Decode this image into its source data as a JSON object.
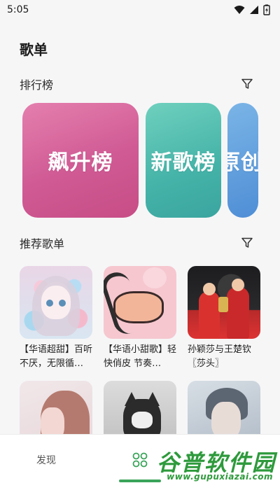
{
  "status": {
    "time": "5:05"
  },
  "page": {
    "title": "歌单"
  },
  "ranking": {
    "title": "排行榜",
    "cards": [
      {
        "label": "飙升榜"
      },
      {
        "label": "新歌榜"
      },
      {
        "label": "原创"
      }
    ]
  },
  "recommended": {
    "title": "推荐歌单",
    "items": [
      {
        "title": "【华语超甜】百听不厌，无限循…"
      },
      {
        "title": "【华语小甜歌】轻快俏皮 节奏…"
      },
      {
        "title": "孙颖莎与王楚钦〖莎头〗"
      },
      {
        "title": ""
      },
      {
        "title": ""
      },
      {
        "title": ""
      }
    ]
  },
  "bottom_nav": {
    "discover_label": "发现",
    "active_color": "#3aa45a"
  },
  "watermark": {
    "main": "谷普软件园",
    "url": "www.gupuxiazai.com"
  },
  "colors": {
    "accent_green": "#3aa45a",
    "card_pink": "#d05a94",
    "card_teal": "#45b3a8",
    "card_blue": "#4f8ed6"
  }
}
